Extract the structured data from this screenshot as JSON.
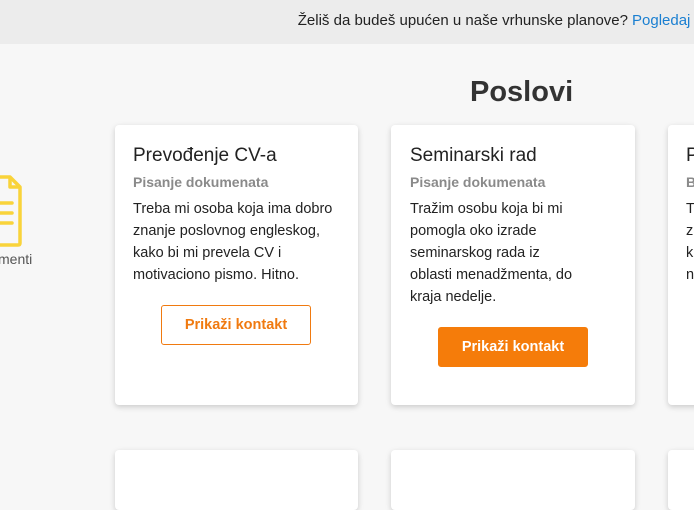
{
  "topbar": {
    "promo_text": "Želiš da budeš upućen u naše vrhunske planove?",
    "promo_link": "Pogledaj"
  },
  "sidebar": {
    "category_label": "menti",
    "icon": "document-icon",
    "icon_color": "#f9d33a"
  },
  "main": {
    "title": "Poslovi",
    "jobs": [
      {
        "title": "Prevođenje CV-a",
        "category": "Pisanje dokumenata",
        "description": "Treba mi osoba koja ima dobro znanje poslovnog engleskog, kako bi mi prevela CV i motivaciono pismo. Hitno.",
        "button_label": "Prikaži kontakt",
        "button_style": "outline"
      },
      {
        "title": "Seminarski rad",
        "category": "Pisanje dokumenata",
        "description": "Tražim osobu koja bi mi pomogla oko izrade seminarskog rada iz oblasti menadžmenta, do kraja nedelje.",
        "button_label": "Prikaži kontakt",
        "button_style": "solid"
      },
      {
        "title": "P",
        "category": "B",
        "description": "T\nz\nk\nn"
      }
    ]
  },
  "colors": {
    "accent": "#f57c0a",
    "link": "#1a7fd1",
    "muted": "#8a8a8a"
  }
}
